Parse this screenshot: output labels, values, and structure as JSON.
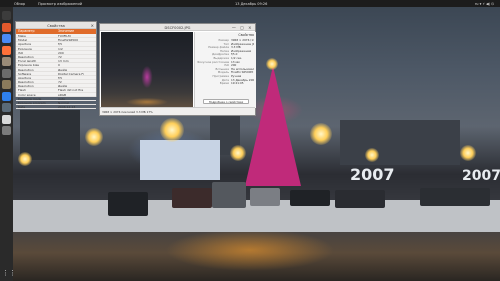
{
  "top_bar": {
    "activities": "Обзор",
    "app_name": "Просмотр изображений",
    "clock": "13 Декабрь 09:26",
    "status": "ru ▾  ⚡ ◀) ⏻"
  },
  "dock": {
    "icons": [
      {
        "name": "terminal-icon",
        "color": "#3c3c3c"
      },
      {
        "name": "ubuntu-software-icon",
        "color": "#e2592c"
      },
      {
        "name": "chrome-icon",
        "color": "#4a8af4"
      },
      {
        "name": "firefox-icon",
        "color": "#ff7139"
      },
      {
        "name": "files-icon",
        "color": "#9a8b78"
      },
      {
        "name": "settings-icon",
        "color": "#6c6c6c"
      },
      {
        "name": "gimp-icon",
        "color": "#8a7a5c"
      },
      {
        "name": "vscode-icon",
        "color": "#2f80ed"
      },
      {
        "name": "photo-icon",
        "color": "#5a6a78"
      },
      {
        "name": "text-editor-icon",
        "color": "#d8d8d8"
      },
      {
        "name": "trash-icon",
        "color": "#7b7b7b"
      }
    ],
    "apps_glyph": "⋮⋮"
  },
  "props_window": {
    "title": "Свойства",
    "close": "×",
    "header": [
      "Параметр",
      "Значение"
    ],
    "rows": [
      [
        "Make",
        "FUJIFILM"
      ],
      [
        "Model",
        "FinePixS6500"
      ],
      [
        "Aperture",
        "f/5"
      ],
      [
        "Exposure",
        "1/2"
      ],
      [
        "ISO",
        "200"
      ],
      [
        "Resolution",
        "72"
      ],
      [
        "Focal length",
        "13 mm"
      ],
      [
        "Exposure bias",
        "0"
      ],
      [
        "Resolution",
        "Дюйм"
      ],
      [
        "Software",
        "Digital Camera Fi"
      ],
      [
        "Aperture",
        "f/5"
      ],
      [
        "Resolution",
        "72"
      ],
      [
        "Resolution",
        "Дюйм"
      ],
      [
        "Flash",
        "Flash did not fire"
      ],
      [
        "Color space",
        "sRGB"
      ],
      [
        "Exposure mode",
        "Auto"
      ],
      [
        "Exposure program",
        "Normal"
      ],
      [
        "Date",
        "2006:12:13"
      ]
    ]
  },
  "viewer": {
    "title": "DSCF0002.JPG",
    "buttons": "— ▢ ×",
    "info_header": "Свойства",
    "info": [
      [
        "Размер",
        "3968 × 2976 (11.8 Мп)"
      ],
      [
        "Тип",
        "Изображение JPEG"
      ],
      [
        "Размер файла",
        "3.3 МБ"
      ],
      [
        "Папка",
        "Изображения"
      ],
      [
        "",
        ""
      ],
      [
        "Диафрагма",
        "f/5.0"
      ],
      [
        "Выдержка",
        "1/2 сек."
      ],
      [
        "Фокусное расстояние",
        "13 мм"
      ],
      [
        "ISO",
        "200"
      ],
      [
        "Вспышка",
        "Не использовалась"
      ],
      [
        "Модель",
        "FinePix S6500fd"
      ],
      [
        "Программа",
        "Ручная"
      ],
      [
        "",
        ""
      ],
      [
        "Дата",
        "13 Декабрь 2006"
      ],
      [
        "Время",
        "19:21:05"
      ]
    ],
    "more_button": "Подробнее о свойствах",
    "status": "3968 × 2976 пикселей  3.3 МБ  17%"
  },
  "wallpaper": {
    "sign_text": "2007"
  }
}
